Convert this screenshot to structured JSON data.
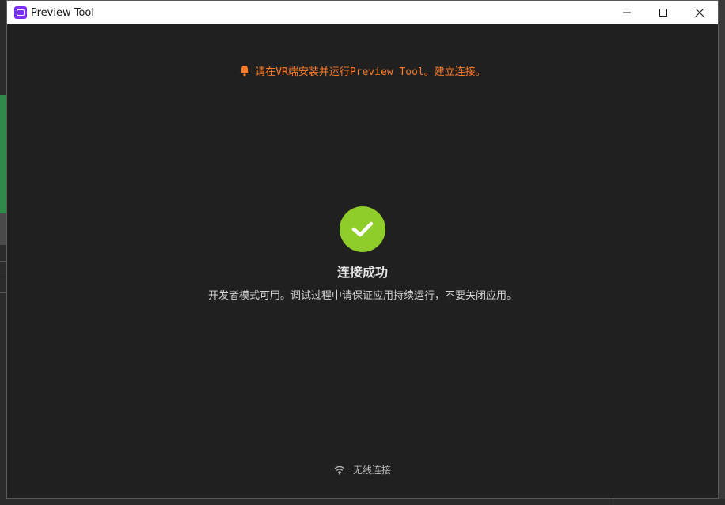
{
  "window": {
    "title": "Preview Tool"
  },
  "notice": {
    "text": "请在VR端安装并运行Preview Tool。建立连接。",
    "color": "#ff7a26",
    "icon": "bell-icon"
  },
  "status": {
    "title": "连接成功",
    "description": "开发者模式可用。调试过程中请保证应用持续运行，不要关闭应用。",
    "icon": "check-circle-icon",
    "color": "#8fce2a"
  },
  "footer": {
    "connection_label": "无线连接",
    "icon": "wifi-icon"
  }
}
